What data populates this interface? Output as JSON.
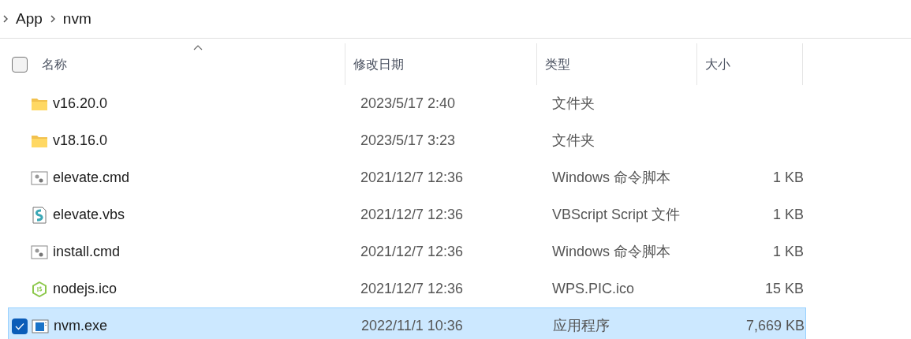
{
  "breadcrumb": [
    "App",
    "nvm"
  ],
  "table": {
    "select_all_checked": false,
    "columns": [
      {
        "label": "名称",
        "sorted": true
      },
      {
        "label": "修改日期",
        "sorted": false
      },
      {
        "label": "类型",
        "sorted": false
      },
      {
        "label": "大小",
        "sorted": false
      }
    ],
    "rows": [
      {
        "kind": "folder",
        "name": "v16.20.0",
        "date": "2023/5/17 2:40",
        "type": "文件夹",
        "selected": false
      },
      {
        "kind": "folder",
        "name": "v18.16.0",
        "date": "2023/5/17 3:23",
        "type": "文件夹",
        "selected": false
      },
      {
        "kind": "script",
        "name": "elevate.cmd",
        "date": "2021/12/7 12:36",
        "type": "Windows 命令脚本",
        "size": "1 KB",
        "selected": false
      },
      {
        "kind": "vbs",
        "name": "elevate.vbs",
        "date": "2021/12/7 12:36",
        "type": "VBScript Script 文件",
        "size": "1 KB",
        "selected": false
      },
      {
        "kind": "script",
        "name": "install.cmd",
        "date": "2021/12/7 12:36",
        "type": "Windows 命令脚本",
        "size": "1 KB",
        "selected": false
      },
      {
        "kind": "nodejs",
        "name": "nodejs.ico",
        "date": "2021/12/7 12:36",
        "type": "WPS.PIC.ico",
        "size": "15 KB",
        "selected": false
      },
      {
        "kind": "exe",
        "name": "nvm.exe",
        "date": "2022/11/1 10:36",
        "type": "应用程序",
        "size": "7,669 KB",
        "selected": true
      }
    ]
  }
}
